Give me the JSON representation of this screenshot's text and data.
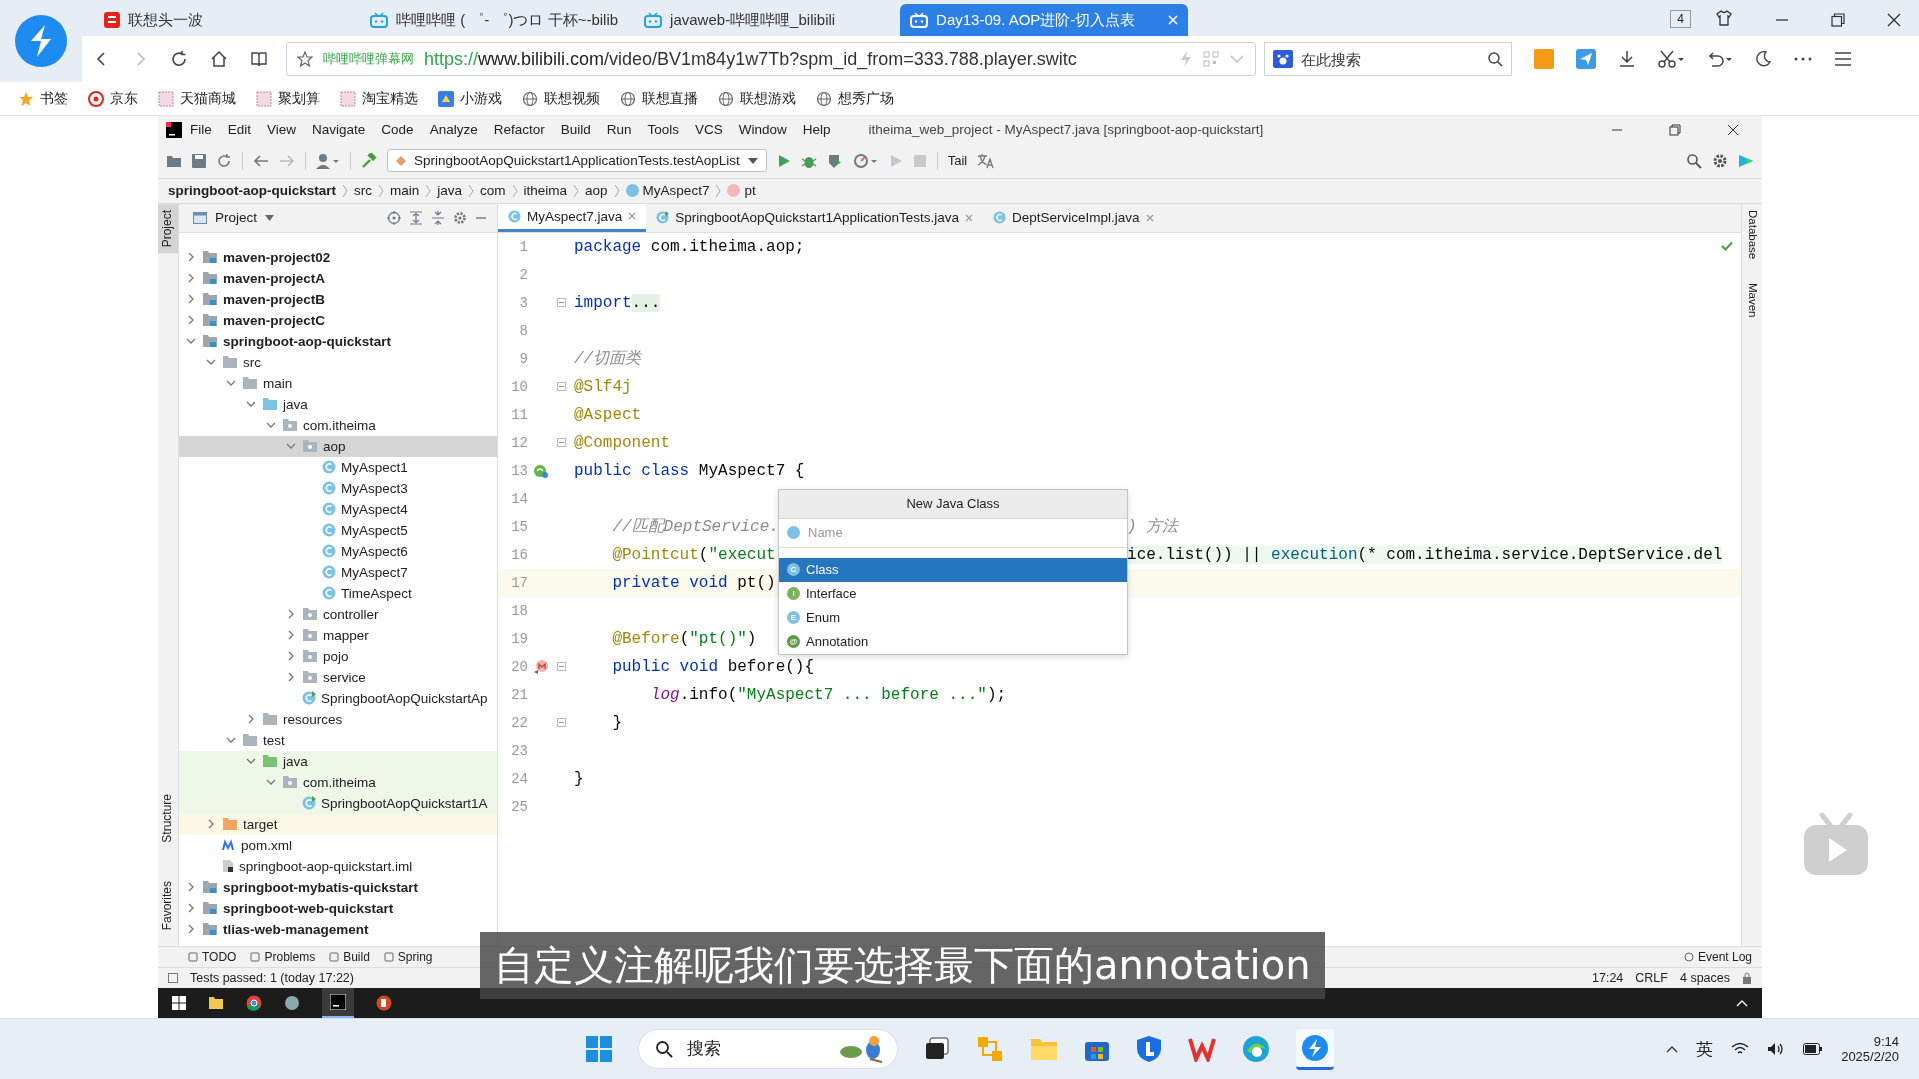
{
  "browser": {
    "tabs": [
      {
        "title": "联想头一波",
        "kind": "news",
        "selected": false
      },
      {
        "title": "哔哩哔哩 ( ゜- ゜)つロ 干杯~-bilib",
        "kind": "tv",
        "selected": false
      },
      {
        "title": "javaweb-哔哩哔哩_bilibili",
        "kind": "tv",
        "selected": false
      },
      {
        "title": "Day13-09. AOP进阶-切入点表",
        "kind": "tv",
        "selected": true
      }
    ],
    "tab_count": "4",
    "address": {
      "site": "哔哩哔哩弹幕网",
      "scheme": "https://",
      "host": "www.bilibili.com",
      "path": "/video/BV1m84y1w7Tb?spm_id_from=333.788.player.switc"
    },
    "search": {
      "placeholder": "在此搜索"
    },
    "bookmarks": [
      {
        "label": "书签",
        "kind": "star"
      },
      {
        "label": "京东",
        "kind": "jd"
      },
      {
        "label": "天猫商城",
        "kind": "page"
      },
      {
        "label": "聚划算",
        "kind": "page"
      },
      {
        "label": "淘宝精选",
        "kind": "page"
      },
      {
        "label": "小游戏",
        "kind": "game"
      },
      {
        "label": "联想视频",
        "kind": "globe"
      },
      {
        "label": "联想直播",
        "kind": "globe"
      },
      {
        "label": "联想游戏",
        "kind": "globe"
      },
      {
        "label": "想秀广场",
        "kind": "globe"
      }
    ]
  },
  "ide": {
    "menu": [
      "File",
      "Edit",
      "View",
      "Navigate",
      "Code",
      "Analyze",
      "Refactor",
      "Build",
      "Run",
      "Tools",
      "VCS",
      "Window",
      "Help"
    ],
    "title": "itheima_web_project - MyAspect7.java [springboot-aop-quickstart]",
    "run_config": "SpringbootAopQuickstart1ApplicationTests.testAopList",
    "tail": "Tail",
    "breadcrumb": [
      {
        "label": "springboot-aop-quickstart",
        "kind": "module"
      },
      {
        "label": "src",
        "kind": "plain"
      },
      {
        "label": "main",
        "kind": "plain"
      },
      {
        "label": "java",
        "kind": "plain"
      },
      {
        "label": "com",
        "kind": "plain"
      },
      {
        "label": "itheima",
        "kind": "plain"
      },
      {
        "label": "aop",
        "kind": "plain"
      },
      {
        "label": "MyAspect7",
        "kind": "class"
      },
      {
        "label": "pt",
        "kind": "method"
      }
    ],
    "left_stripe": {
      "top": [
        {
          "label": "Project",
          "selected": true
        }
      ],
      "bottom": [
        {
          "label": "Structure",
          "selected": false
        },
        {
          "label": "Favorites",
          "selected": false
        }
      ]
    },
    "right_stripe": [
      "Database",
      "Maven"
    ],
    "project_panel": {
      "title": "Project",
      "tree": [
        {
          "label": "maven-project02",
          "kind": "module",
          "expanded": false,
          "selected": false
        },
        {
          "label": "maven-projectA",
          "kind": "module",
          "expanded": false,
          "selected": false
        },
        {
          "label": "maven-projectB",
          "kind": "module",
          "expanded": false,
          "selected": false
        },
        {
          "label": "maven-projectC",
          "kind": "module",
          "expanded": false,
          "selected": false
        },
        {
          "label": "springboot-aop-quickstart",
          "kind": "module",
          "expanded": true,
          "selected": false,
          "children": [
            {
              "label": "src",
              "kind": "folder",
              "expanded": true,
              "selected": false,
              "children": [
                {
                  "label": "main",
                  "kind": "folder",
                  "expanded": true,
                  "selected": false,
                  "children": [
                    {
                      "label": "java",
                      "kind": "source",
                      "expanded": true,
                      "selected": false,
                      "children": [
                        {
                          "label": "com.itheima",
                          "kind": "package",
                          "expanded": true,
                          "selected": false,
                          "children": [
                            {
                              "label": "aop",
                              "kind": "package",
                              "expanded": true,
                              "selected": true,
                              "children": [
                                {
                                  "label": "MyAspect1",
                                  "kind": "class",
                                  "selected": false
                                },
                                {
                                  "label": "MyAspect3",
                                  "kind": "class",
                                  "selected": false
                                },
                                {
                                  "label": "MyAspect4",
                                  "kind": "class",
                                  "selected": false
                                },
                                {
                                  "label": "MyAspect5",
                                  "kind": "class",
                                  "selected": false
                                },
                                {
                                  "label": "MyAspect6",
                                  "kind": "class",
                                  "selected": false
                                },
                                {
                                  "label": "MyAspect7",
                                  "kind": "class",
                                  "selected": false
                                },
                                {
                                  "label": "TimeAspect",
                                  "kind": "class",
                                  "selected": false
                                }
                              ]
                            },
                            {
                              "label": "controller",
                              "kind": "package",
                              "expanded": false,
                              "selected": false
                            },
                            {
                              "label": "mapper",
                              "kind": "package",
                              "expanded": false,
                              "selected": false
                            },
                            {
                              "label": "pojo",
                              "kind": "package",
                              "expanded": false,
                              "selected": false
                            },
                            {
                              "label": "service",
                              "kind": "package",
                              "expanded": false,
                              "selected": false
                            },
                            {
                              "label": "SpringbootAopQuickstartAp",
                              "kind": "app-class",
                              "selected": false
                            }
                          ]
                        }
                      ]
                    },
                    {
                      "label": "resources",
                      "kind": "resources",
                      "expanded": false,
                      "selected": false
                    }
                  ]
                },
                {
                  "label": "test",
                  "kind": "folder",
                  "expanded": true,
                  "selected": false,
                  "children": [
                    {
                      "label": "java",
                      "kind": "test-source",
                      "expanded": true,
                      "selected": false,
                      "children": [
                        {
                          "label": "com.itheima",
                          "kind": "test-package",
                          "expanded": true,
                          "selected": false,
                          "children": [
                            {
                              "label": "SpringbootAopQuickstart1A",
                              "kind": "test-class",
                              "selected": false
                            }
                          ]
                        }
                      ]
                    }
                  ]
                }
              ]
            },
            {
              "label": "target",
              "kind": "excluded",
              "expanded": false,
              "selected": false
            },
            {
              "label": "pom.xml",
              "kind": "maven",
              "selected": false
            },
            {
              "label": "springboot-aop-quickstart.iml",
              "kind": "iml",
              "selected": false
            }
          ]
        },
        {
          "label": "springboot-mybatis-quickstart",
          "kind": "module",
          "expanded": false,
          "selected": false
        },
        {
          "label": "springboot-web-quickstart",
          "kind": "module",
          "expanded": false,
          "selected": false
        },
        {
          "label": "tlias-web-management",
          "kind": "module",
          "expanded": false,
          "selected": false
        }
      ]
    },
    "editor_tabs": [
      {
        "label": "MyAspect7.java",
        "kind": "class",
        "selected": true
      },
      {
        "label": "SpringbootAopQuickstart1ApplicationTests.java",
        "kind": "test",
        "selected": false
      },
      {
        "label": "DeptServiceImpl.java",
        "kind": "class",
        "selected": false
      }
    ],
    "code": [
      {
        "number": "1",
        "current": false,
        "segments": [
          {
            "kind": "kw",
            "text": "package"
          },
          {
            "kind": "plain",
            "text": " com.itheima.aop;"
          }
        ]
      },
      {
        "number": "2",
        "current": false
      },
      {
        "number": "3",
        "current": false,
        "segments": [
          {
            "kind": "kw",
            "text": "import"
          },
          {
            "kind": "folded",
            "text": "..."
          }
        ]
      },
      {
        "number": "8",
        "current": false
      },
      {
        "number": "9",
        "current": false,
        "segments": [
          {
            "kind": "cmt",
            "text": "//切面类"
          }
        ]
      },
      {
        "number": "10",
        "current": false,
        "segments": [
          {
            "kind": "ann",
            "text": "@Slf4j"
          }
        ]
      },
      {
        "number": "11",
        "current": false,
        "segments": [
          {
            "kind": "ann",
            "text": "@Aspect"
          }
        ]
      },
      {
        "number": "12",
        "current": false,
        "segments": [
          {
            "kind": "ann",
            "text": "@Component"
          }
        ]
      },
      {
        "number": "13",
        "current": false,
        "segments": [
          {
            "kind": "kw",
            "text": "public class"
          },
          {
            "kind": "plain",
            "text": " MyAspect7 {"
          }
        ]
      },
      {
        "number": "14",
        "current": false
      },
      {
        "number": "15",
        "current": false,
        "segments": [
          {
            "kind": "cmt",
            "text": "    //匹配DeptService."
          }
        ],
        "right": [
          {
            "kind": "cmt",
            "text": ") 方法"
          }
        ]
      },
      {
        "number": "16",
        "current": false,
        "segments": [
          {
            "kind": "ann",
            "text": "    @Pointcut"
          },
          {
            "kind": "plain",
            "text": "("
          },
          {
            "kind": "str",
            "text": "\"execut"
          }
        ],
        "right": [
          {
            "kind": "inj",
            "text": "ice.list()) || "
          },
          {
            "kind": "injfn",
            "text": "execution"
          },
          {
            "kind": "inj",
            "text": "(* com.itheima.service.DeptService.del"
          }
        ]
      },
      {
        "number": "17",
        "current": true,
        "segments": [
          {
            "kind": "kw",
            "text": "    private void"
          },
          {
            "kind": "plain",
            "text": " pt()"
          }
        ]
      },
      {
        "number": "18",
        "current": false
      },
      {
        "number": "19",
        "current": false,
        "segments": [
          {
            "kind": "ann",
            "text": "    @Before"
          },
          {
            "kind": "plain",
            "text": "("
          },
          {
            "kind": "str",
            "text": "\"pt()\""
          },
          {
            "kind": "plain",
            "text": ")"
          }
        ]
      },
      {
        "number": "20",
        "current": false,
        "segments": [
          {
            "kind": "kw",
            "text": "    public void"
          },
          {
            "kind": "plain",
            "text": " before(){"
          }
        ]
      },
      {
        "number": "21",
        "current": false,
        "segments": [
          {
            "kind": "field",
            "text": "        log"
          },
          {
            "kind": "plain",
            "text": ".info("
          },
          {
            "kind": "str",
            "text": "\"MyAspect7 ... before ...\""
          },
          {
            "kind": "plain",
            "text": ");"
          }
        ]
      },
      {
        "number": "22",
        "current": false,
        "segments": [
          {
            "kind": "plain",
            "text": "    }"
          }
        ]
      },
      {
        "number": "23",
        "current": false
      },
      {
        "number": "24",
        "current": false,
        "segments": [
          {
            "kind": "plain",
            "text": "}"
          }
        ]
      },
      {
        "number": "25",
        "current": false
      }
    ],
    "popup": {
      "title": "New Java Class",
      "placeholder": "Name",
      "items": [
        {
          "label": "Class",
          "badge": "C",
          "selected": true
        },
        {
          "label": "Interface",
          "badge": "I",
          "selected": false
        },
        {
          "label": "Enum",
          "badge": "E",
          "selected": false
        },
        {
          "label": "Annotation",
          "badge": "@",
          "selected": false
        }
      ]
    },
    "bottom_tabs": [
      "TODO",
      "Problems",
      "Build",
      "Spring"
    ],
    "event_log": "Event Log",
    "status": {
      "message": "Tests passed: 1 (today 17:22)",
      "position": "17:24",
      "line_sep": "CRLF",
      "indent": "4 spaces"
    }
  },
  "subtitle": "自定义注解呢我们要选择最下面的annotation",
  "taskbar": {
    "search": {
      "placeholder": "搜索"
    },
    "ime": "英",
    "time": "9:14",
    "date": "2025/2/20"
  }
}
